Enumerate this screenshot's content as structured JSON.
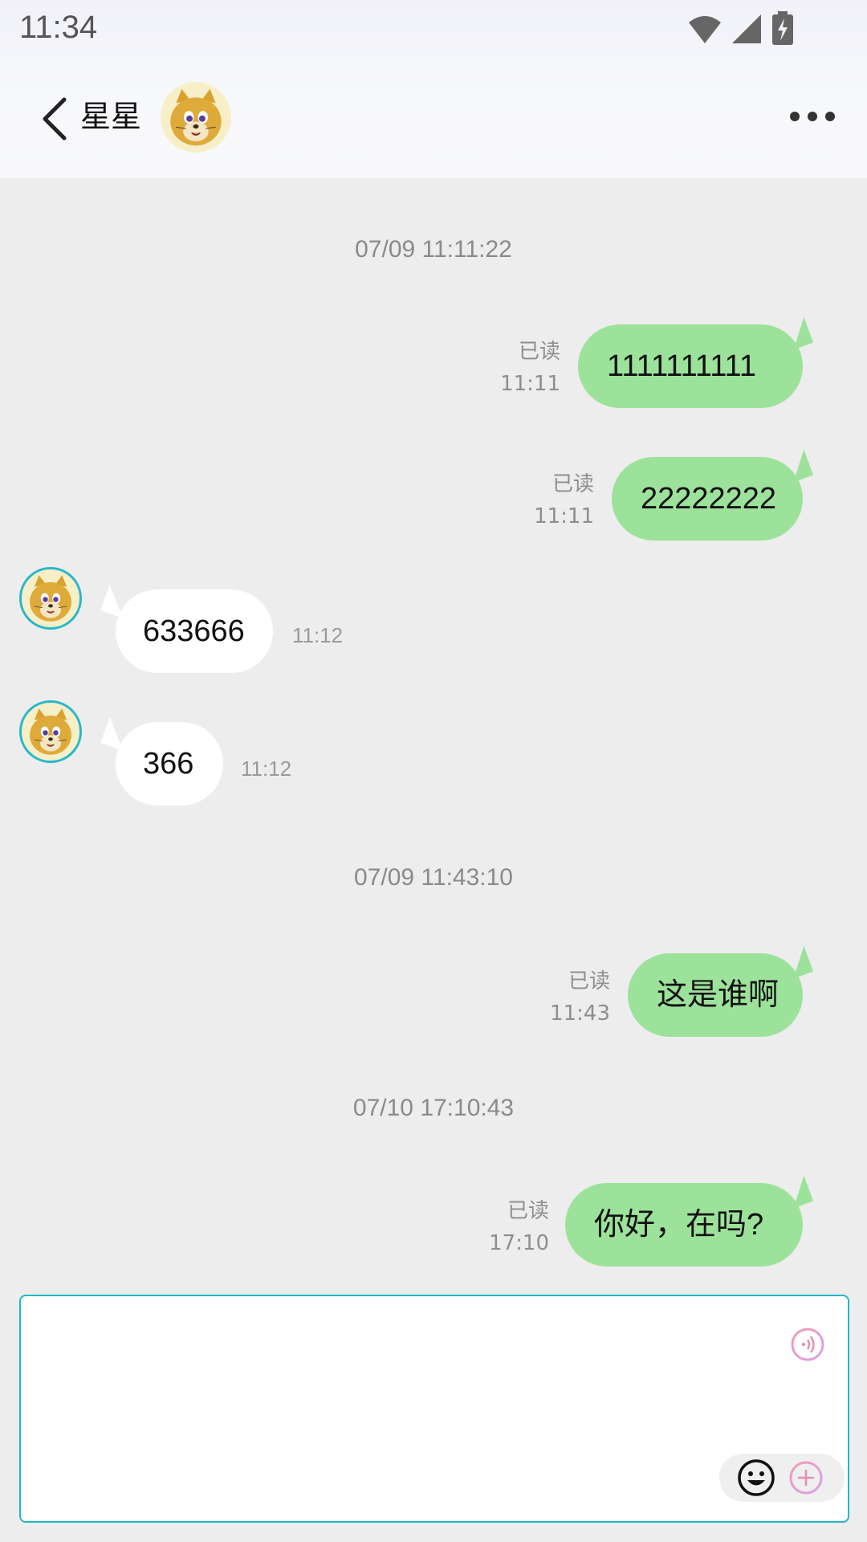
{
  "status_bar": {
    "time": "11:34",
    "icons": [
      "wifi-icon",
      "cell-signal-icon",
      "battery-charging-icon"
    ]
  },
  "header": {
    "contact_name": "星星",
    "avatar": "cat-avatar",
    "back_icon": "chevron-left-icon",
    "more_icon": "more-horizontal-icon"
  },
  "messages": [
    {
      "type": "divider",
      "text": "07/09 11:11:22"
    },
    {
      "type": "outgoing",
      "text": "1111111111",
      "read": "已读",
      "time": "11:11"
    },
    {
      "type": "outgoing",
      "text": "22222222",
      "read": "已读",
      "time": "11:11"
    },
    {
      "type": "incoming",
      "text": "633666",
      "time": "11:12"
    },
    {
      "type": "incoming",
      "text": "366",
      "time": "11:12"
    },
    {
      "type": "divider",
      "text": "07/09 11:43:10"
    },
    {
      "type": "outgoing",
      "text": "这是谁啊",
      "read": "已读",
      "time": "11:43"
    },
    {
      "type": "divider",
      "text": "07/10 17:10:43"
    },
    {
      "type": "outgoing",
      "text": "你好，在吗?",
      "read": "已读",
      "time": "17:10"
    }
  ],
  "composer": {
    "value": "",
    "placeholder": "",
    "voice_icon": "voice-wave-icon",
    "emoji_icon": "emoji-icon",
    "plus_icon": "plus-circle-icon"
  },
  "colors": {
    "outgoing_bubble": "#9ce29a",
    "incoming_bubble": "#ffffff",
    "background": "#ededed",
    "accent": "#22b8c4"
  }
}
